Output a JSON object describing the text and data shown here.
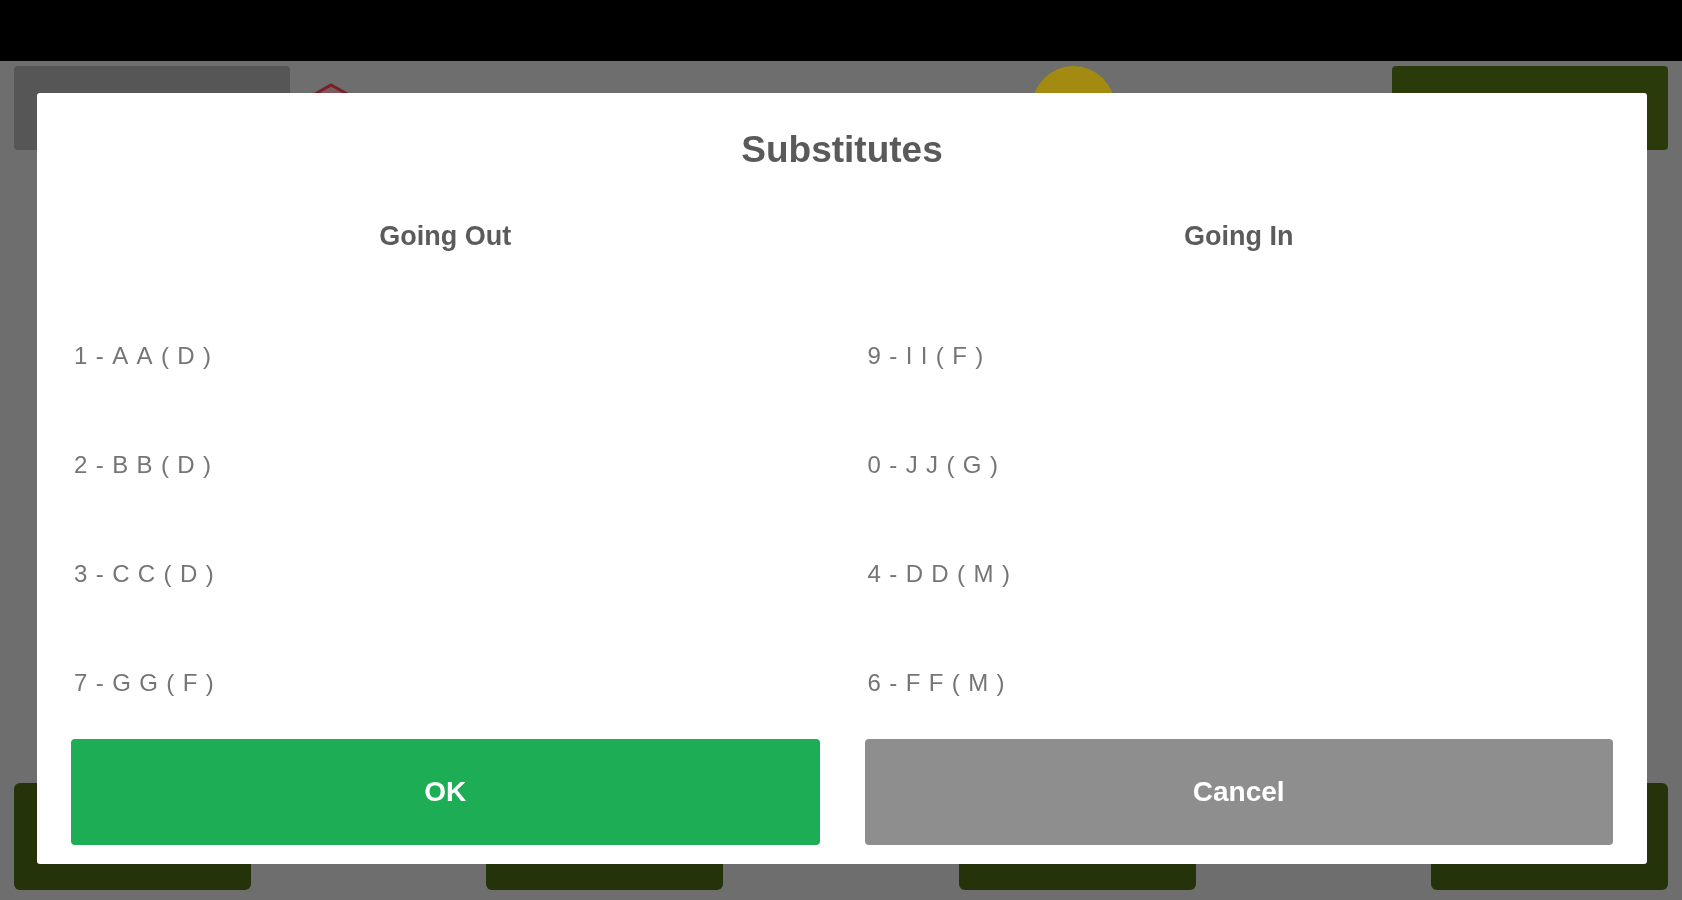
{
  "dialog": {
    "title": "Substitutes",
    "columns": [
      {
        "heading": "Going Out",
        "players": [
          "1-AA(D)",
          "2-BB(D)",
          "3-CC(D)",
          "7-GG(F)"
        ]
      },
      {
        "heading": "Going In",
        "players": [
          "9-II(F)",
          "0-JJ(G)",
          "4-DD(M)",
          "6-FF(M)"
        ]
      }
    ],
    "buttons": [
      {
        "label": "OK",
        "kind": "primary"
      },
      {
        "label": "Cancel",
        "kind": "secondary"
      }
    ]
  }
}
